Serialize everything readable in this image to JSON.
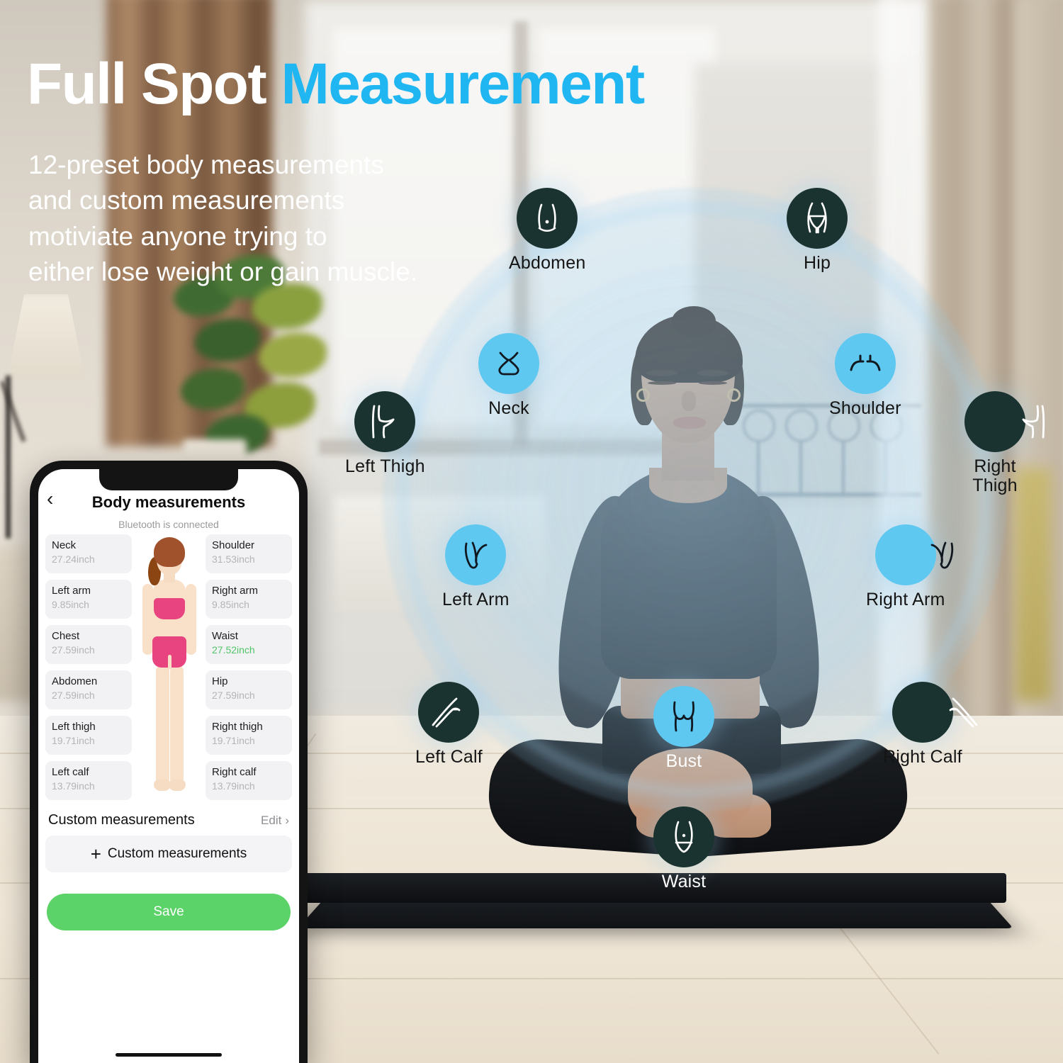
{
  "headline": {
    "part1": "Full Spot",
    "part2": "Measurement"
  },
  "subcopy": {
    "line1": "12-preset body measurements",
    "line2": "and custom measurements",
    "line3": "motiviate anyone trying to",
    "line4": "either lose weight or gain muscle."
  },
  "colors": {
    "accent_cyan": "#1fb6f2",
    "badge_cyan": "#5ec8f0",
    "badge_dark": "#1b3330",
    "save_green": "#5cd368",
    "value_green": "#52c468"
  },
  "badges": [
    {
      "id": "abdomen",
      "label": "Abdomen",
      "icon": "abdomen-icon",
      "style": "dark",
      "label_color": "black"
    },
    {
      "id": "hip",
      "label": "Hip",
      "icon": "hip-icon",
      "style": "dark",
      "label_color": "black"
    },
    {
      "id": "neck",
      "label": "Neck",
      "icon": "neck-icon",
      "style": "cyan",
      "label_color": "black"
    },
    {
      "id": "shoulder",
      "label": "Shoulder",
      "icon": "shoulder-icon",
      "style": "cyan",
      "label_color": "black"
    },
    {
      "id": "left-thigh",
      "label": "Left Thigh",
      "icon": "thigh-left-icon",
      "style": "dark",
      "label_color": "black"
    },
    {
      "id": "right-thigh",
      "label": "Right Thigh",
      "icon": "thigh-right-icon",
      "style": "dark",
      "label_color": "black"
    },
    {
      "id": "left-arm",
      "label": "Left Arm",
      "icon": "arm-left-icon",
      "style": "cyan",
      "label_color": "black"
    },
    {
      "id": "right-arm",
      "label": "Right Arm",
      "icon": "arm-right-icon",
      "style": "cyan",
      "label_color": "black"
    },
    {
      "id": "left-calf",
      "label": "Left Calf",
      "icon": "calf-left-icon",
      "style": "dark",
      "label_color": "black"
    },
    {
      "id": "right-calf",
      "label": "Right Calf",
      "icon": "calf-right-icon",
      "style": "dark",
      "label_color": "black"
    },
    {
      "id": "bust",
      "label": "Bust",
      "icon": "bust-icon",
      "style": "cyan",
      "label_color": "white"
    },
    {
      "id": "waist",
      "label": "Waist",
      "icon": "waist-icon",
      "style": "dark",
      "label_color": "white"
    }
  ],
  "phone": {
    "back_icon": "back-chevron-icon",
    "title": "Body measurements",
    "bluetooth_status": "Bluetooth is connected",
    "measurements_left": [
      {
        "label": "Neck",
        "value": "27.24inch",
        "highlight": false
      },
      {
        "label": "Left arm",
        "value": "9.85inch",
        "highlight": false
      },
      {
        "label": "Chest",
        "value": "27.59inch",
        "highlight": false
      },
      {
        "label": "Abdomen",
        "value": "27.59inch",
        "highlight": false
      },
      {
        "label": "Left thigh",
        "value": "19.71inch",
        "highlight": false
      },
      {
        "label": "Left calf",
        "value": "13.79inch",
        "highlight": false
      }
    ],
    "measurements_right": [
      {
        "label": "Shoulder",
        "value": "31.53inch",
        "highlight": false
      },
      {
        "label": "Right arm",
        "value": "9.85inch",
        "highlight": false
      },
      {
        "label": "Waist",
        "value": "27.52inch",
        "highlight": true
      },
      {
        "label": "Hip",
        "value": "27.59inch",
        "highlight": false
      },
      {
        "label": "Right thigh",
        "value": "19.71inch",
        "highlight": false
      },
      {
        "label": "Right calf",
        "value": "13.79inch",
        "highlight": false
      }
    ],
    "custom_section_title": "Custom measurements",
    "edit_label": "Edit",
    "edit_chevron": "chevron-right-icon",
    "add_custom_label": "Custom measurements",
    "add_plus_icon": "plus-icon",
    "save_label": "Save"
  }
}
